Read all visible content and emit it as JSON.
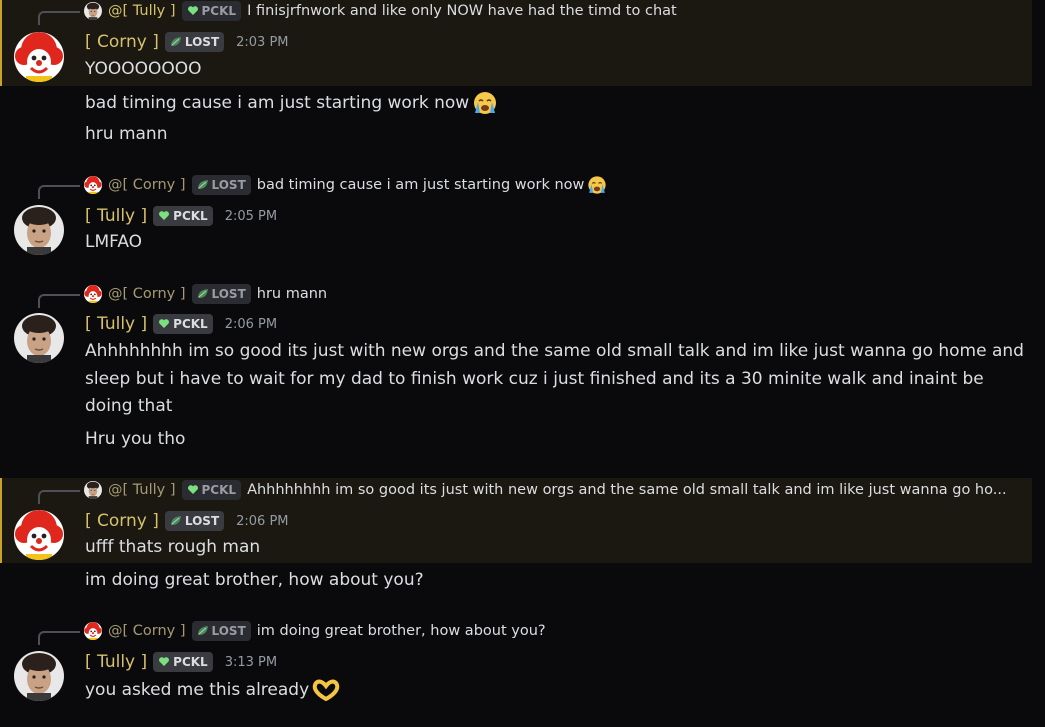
{
  "users": {
    "tully": {
      "name": "[ Tully ]",
      "tag": "PCKL",
      "mention": "@[ Tully ]"
    },
    "corny": {
      "name": "[ Corny ]",
      "tag": "LOST",
      "mention": "@[ Corny ]"
    }
  },
  "colors": {
    "name": "#d7c16c",
    "highlight_bg": "#1a1810",
    "highlight_edge": "#c9a227",
    "background": "#0a0a0d"
  },
  "messages": [
    {
      "author": "[ Corny ]",
      "tag": "LOST",
      "time": "2:03 PM",
      "reply_to": {
        "mention": "@[ Tully ]",
        "tag": "PCKL",
        "text": "I finisjrfnwork and like only NOW have had the timd to chat"
      },
      "lines": [
        "YOOOOOOOO",
        "bad timing cause i am just starting work now",
        "hru mann"
      ]
    },
    {
      "author": "[ Tully ]",
      "tag": "PCKL",
      "time": "2:05 PM",
      "reply_to": {
        "mention": "@[ Corny ]",
        "tag": "LOST",
        "text": "bad timing cause i am just starting work now"
      },
      "lines": [
        "LMFAO"
      ]
    },
    {
      "author": "[ Tully ]",
      "tag": "PCKL",
      "time": "2:06 PM",
      "reply_to": {
        "mention": "@[ Corny ]",
        "tag": "LOST",
        "text": "hru mann"
      },
      "lines": [
        "Ahhhhhhhh im so good its just with new orgs and the same old small talk and im like just wanna go home and sleep but i have to wait for my dad to finish work cuz i just finished and its a 30 minite walk and inaint be doing that",
        "Hru you tho"
      ]
    },
    {
      "author": "[ Corny ]",
      "tag": "LOST",
      "time": "2:06 PM",
      "reply_to": {
        "mention": "@[ Tully ]",
        "tag": "PCKL",
        "text": "Ahhhhhhhh im so good its just with new orgs and the same old small talk and im like just wanna go ho..."
      },
      "lines": [
        "ufff thats rough man",
        "im doing great brother, how about you?"
      ]
    },
    {
      "author": "[ Tully ]",
      "tag": "PCKL",
      "time": "3:13 PM",
      "reply_to": {
        "mention": "@[ Corny ]",
        "tag": "LOST",
        "text": "im doing great brother, how about you?"
      },
      "lines": [
        "you asked me this already"
      ]
    }
  ],
  "icons": {
    "sob_emoji": "loudly-crying-face",
    "heart_hands_emoji": "heart-hands",
    "pckl_badge": "green-heart-icon",
    "lost_badge": "leaf-icon"
  }
}
